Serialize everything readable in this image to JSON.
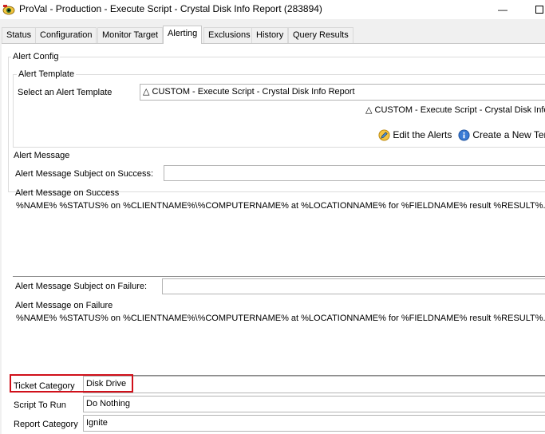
{
  "window": {
    "title": "ProVal - Production - Execute Script - Crystal Disk Info Report (283894)",
    "minimize_glyph": "—",
    "icon": "eye-icon"
  },
  "tabs": [
    {
      "label": "Status"
    },
    {
      "label": "Configuration"
    },
    {
      "label": "Monitor Target"
    },
    {
      "label": "Alerting",
      "active": true
    },
    {
      "label": "Exclusions"
    },
    {
      "label": "History"
    },
    {
      "label": "Query Results"
    }
  ],
  "alert_config": {
    "group_label": "Alert Config",
    "template_group_label": "Alert Template",
    "select_label": "Select an Alert Template",
    "selected_template": "△ CUSTOM - Execute Script - Crystal Disk Info Report",
    "template_preview": "△ CUSTOM - Execute Script - Crystal Disk Info",
    "edit_alerts_label": "Edit the Alerts",
    "create_template_label": "Create a New Tem"
  },
  "alert_message": {
    "group_label": "Alert Message",
    "subject_success_label": "Alert Message Subject on Success:",
    "subject_success_value": "",
    "message_success_label": "Alert Message on Success",
    "message_success_value": "%NAME% %STATUS% on %CLIENTNAME%\\%COMPUTERNAME% at %LOCATIONNAME% for %FIELDNAME% result %RESULT%.",
    "subject_failure_label": "Alert Message Subject on Failure:",
    "subject_failure_value": "",
    "message_failure_label": "Alert Message on Failure",
    "message_failure_value": "%NAME% %STATUS% on %CLIENTNAME%\\%COMPUTERNAME% at %LOCATIONNAME% for %FIELDNAME% result %RESULT%."
  },
  "fields": {
    "ticket_category_label": "Ticket Category",
    "ticket_category_value": "Disk Drive",
    "script_label": "Script To Run",
    "script_value": "Do Nothing",
    "report_category_label": "Report Category",
    "report_category_value": "Ignite"
  },
  "colors": {
    "highlight": "#d0101a",
    "window_bg": "#f0f0f0"
  }
}
